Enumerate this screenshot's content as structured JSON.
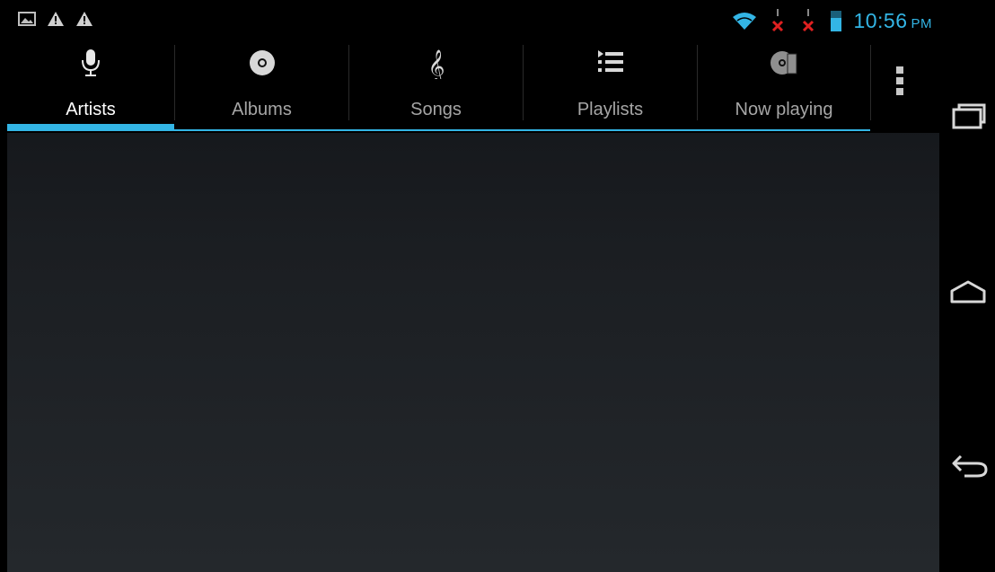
{
  "status_bar": {
    "time": "10:56",
    "ampm": "PM",
    "left_icons": [
      "gallery-notification-icon",
      "warning-icon",
      "warning-icon"
    ],
    "right_icons": [
      "wifi-icon",
      "no-signal-icon",
      "no-signal-icon",
      "battery-icon"
    ]
  },
  "tabs": [
    {
      "label": "Artists",
      "icon": "microphone-icon",
      "selected": true
    },
    {
      "label": "Albums",
      "icon": "album-disc-icon",
      "selected": false
    },
    {
      "label": "Songs",
      "icon": "treble-clef-icon",
      "selected": false
    },
    {
      "label": "Playlists",
      "icon": "playlist-icon",
      "selected": false
    },
    {
      "label": "Now playing",
      "icon": "now-playing-icon",
      "selected": false
    }
  ],
  "nav_bar": {
    "buttons": [
      "recent-apps",
      "home",
      "back"
    ]
  },
  "colors": {
    "accent": "#33b5e5",
    "tab_text": "#a6a6a6",
    "tab_text_selected": "#ffffff",
    "background": "#000000"
  }
}
